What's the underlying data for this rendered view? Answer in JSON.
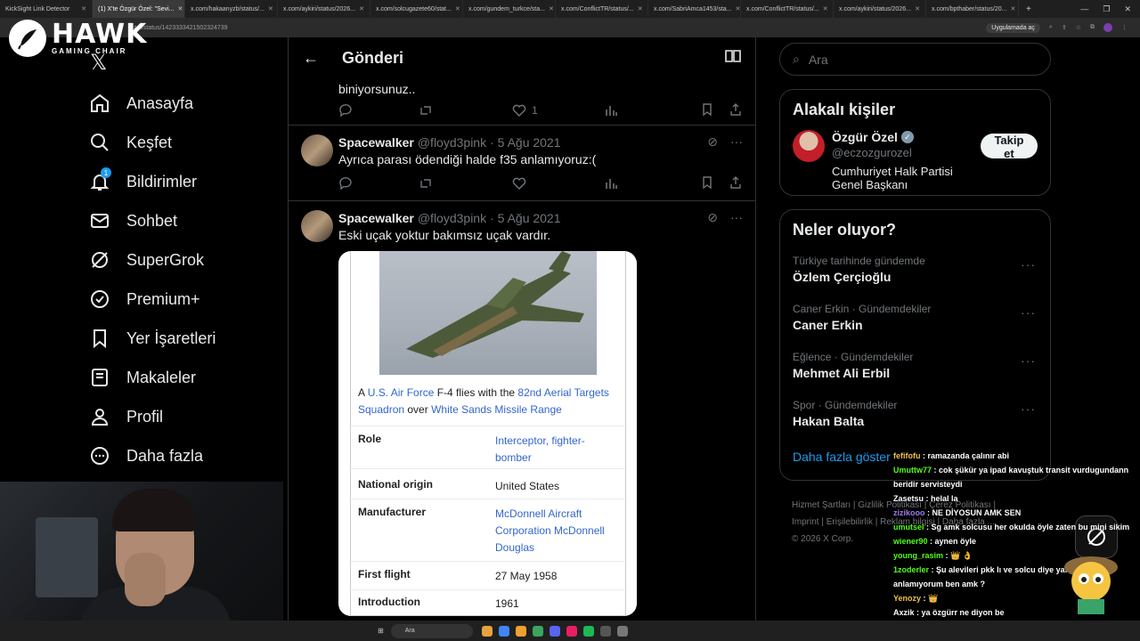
{
  "browser": {
    "tabs": [
      {
        "label": "KickSight Link Detector",
        "active": false
      },
      {
        "label": "(1) X'te Özgür Özel: \"Sevi...",
        "active": true
      },
      {
        "label": "x.com/hakaanyzb/status/...",
        "active": false
      },
      {
        "label": "x.com/aykiri/status/2026...",
        "active": false
      },
      {
        "label": "x.com/solcugazete60/stat...",
        "active": false
      },
      {
        "label": "x.com/gundem_turkce/sta...",
        "active": false
      },
      {
        "label": "x.com/ConflictTR/status/...",
        "active": false
      },
      {
        "label": "x.com/SabriAmca1453/sta...",
        "active": false
      },
      {
        "label": "x.com/ConflictTR/status/...",
        "active": false
      },
      {
        "label": "x.com/aykiri/status/2026...",
        "active": false
      },
      {
        "label": "x.com/bpthaber/status/20...",
        "active": false
      }
    ],
    "url": "zel/status/1423333421502324739",
    "app_button": "Uygulamada aç"
  },
  "overlay_logo": {
    "name": "HAWK",
    "sub": "GAMING CHAIR"
  },
  "nav": {
    "items": [
      {
        "label": "Anasayfa",
        "icon": "home-icon"
      },
      {
        "label": "Keşfet",
        "icon": "search-icon"
      },
      {
        "label": "Bildirimler",
        "icon": "bell-icon",
        "badge": "1"
      },
      {
        "label": "Sohbet",
        "icon": "mail-icon"
      },
      {
        "label": "SuperGrok",
        "icon": "grok-icon"
      },
      {
        "label": "Premium+",
        "icon": "verified-icon"
      },
      {
        "label": "Yer İşaretleri",
        "icon": "bookmark-icon"
      },
      {
        "label": "Makaleler",
        "icon": "article-icon"
      },
      {
        "label": "Profil",
        "icon": "person-icon"
      },
      {
        "label": "Daha fazla",
        "icon": "more-circle-icon"
      }
    ]
  },
  "main": {
    "title": "Gönderi",
    "prev_tweet_tail": "biniyorsunuz..",
    "prev_like_count": "1",
    "tweets": [
      {
        "name": "Spacewalker",
        "handle": "@floyd3pink",
        "date": "· 5 Ağu 2021",
        "text": "Ayrıca parası ödendiği halde f35 anlamıyoruz:("
      },
      {
        "name": "Spacewalker",
        "handle": "@floyd3pink",
        "date": "· 5 Ağu 2021",
        "text": "Eski uçak yoktur bakımsız uçak vardır."
      }
    ],
    "wiki": {
      "caption_pre": "A ",
      "caption_link1": "U.S. Air Force",
      "caption_mid": " F-4 flies with the ",
      "caption_link2": "82nd Aerial Targets Squadron",
      "caption_mid2": " over ",
      "caption_link3": "White Sands Missile Range",
      "rows": [
        {
          "key": "Role",
          "value": "Interceptor, fighter-bomber",
          "link": true
        },
        {
          "key": "National origin",
          "value": "United States",
          "link": false
        },
        {
          "key": "Manufacturer",
          "value": "McDonnell Aircraft Corporation McDonnell Douglas",
          "link": true
        },
        {
          "key": "First flight",
          "value": "27 May 1958",
          "link": false
        },
        {
          "key": "Introduction",
          "value": "1961",
          "link": false
        }
      ]
    }
  },
  "right": {
    "search_placeholder": "Ara",
    "related_title": "Alakalı kişiler",
    "person": {
      "name": "Özgür Özel",
      "handle": "@eczozgurozel",
      "bio": "Cumhuriyet Halk Partisi Genel Başkanı",
      "follow_label": "Takip et"
    },
    "trends_title": "Neler oluyor?",
    "trends": [
      {
        "meta": "Türkiye tarihinde gündemde",
        "title": "Özlem Çerçioğlu"
      },
      {
        "meta": "Caner Erkin · Gündemdekiler",
        "title": "Caner Erkin"
      },
      {
        "meta": "Eğlence · Gündemdekiler",
        "title": "Mehmet Ali Erbil"
      },
      {
        "meta": "Spor · Gündemdekiler",
        "title": "Hakan Balta"
      }
    ],
    "show_more": "Daha fazla göster",
    "footer_line1": "Hizmet Şartları  |  Gizlilik Politikası  |  Çerez Politikası  |",
    "footer_line2": "Imprint  |  Erişilebilirlik  |  Reklam bilgisi  |  Daha fazla ...",
    "footer_line3": "© 2026 X Corp."
  },
  "chat": [
    {
      "user": "fefifofu",
      "color": "#f0c14b",
      "msg": ": ramazanda çalınır abi"
    },
    {
      "user": "Umuttw77",
      "color": "#53fc18",
      "msg": ": cok şükür ya ipad kavuştuk transit vurdugundann beridir servisteydi"
    },
    {
      "user": "Zasetsu",
      "color": "#ffffff",
      "msg": ": helal la"
    },
    {
      "user": "zizikooo",
      "color": "#9f7aea",
      "msg": ": NE DİYOSUN AMK SEN"
    },
    {
      "user": "umutsel",
      "color": "#53fc18",
      "msg": ": Sg amk solcusu her okulda öyle zaten bu mini sikim"
    },
    {
      "user": "wiener90",
      "color": "#53fc18",
      "msg": ": aynen öyle"
    },
    {
      "user": "young_rasim",
      "color": "#53fc18",
      "msg": ": 👑 👌"
    },
    {
      "user": "1zoderler",
      "color": "#53fc18",
      "msg": ": Şu alevileri pkk lı ve solcu diye yaftalamanızı anlamıyorum ben amk ?"
    },
    {
      "user": "Yenozy",
      "color": "#f0c14b",
      "msg": ": 👑"
    },
    {
      "user": "Axzik",
      "color": "#ffffff",
      "msg": ": ya özgürr ne diyon be"
    }
  ],
  "taskbar": {
    "search_placeholder": "Ara"
  }
}
